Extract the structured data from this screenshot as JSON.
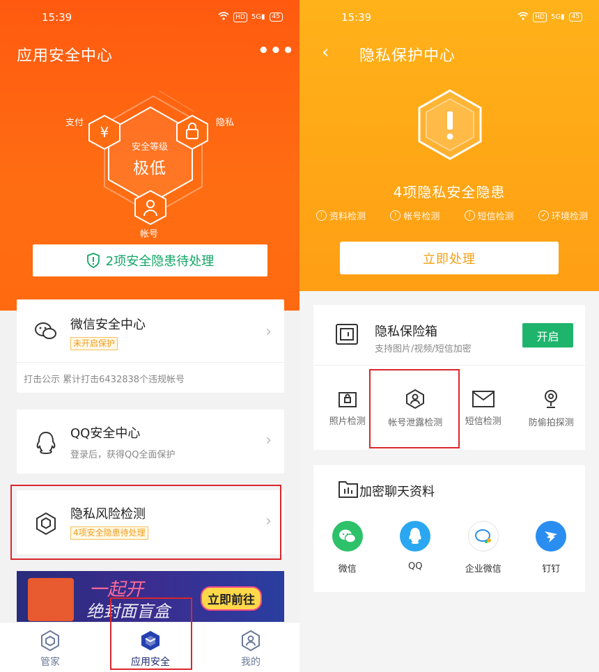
{
  "left": {
    "status_time": "15:39",
    "status_hd": "HD",
    "status_signal": "5G",
    "status_battery": "45",
    "title": "应用安全中心",
    "more_label": "•••",
    "hex_labels": {
      "pay": "支付",
      "privacy": "隐私",
      "account": "帐号"
    },
    "level_label": "安全等级",
    "level_value": "极低",
    "alert_text": "2项安全隐患待处理",
    "wechat": {
      "title": "微信安全中心",
      "badge": "未开启保护",
      "footnote": "打击公示   累计打击6432838个违规帐号"
    },
    "qq": {
      "title": "QQ安全中心",
      "sub": "登录后，获得QQ全面保护"
    },
    "privacy": {
      "title": "隐私风险检测",
      "badge": "4项安全隐患待处理"
    },
    "banner": {
      "text1": "一起开",
      "text2": "绝封面盲盒",
      "button": "立即前往"
    },
    "tabs": [
      {
        "label": "管家"
      },
      {
        "label": "应用安全"
      },
      {
        "label": "我的"
      }
    ]
  },
  "right": {
    "status_time": "15:39",
    "status_hd": "HD",
    "status_signal": "5G",
    "status_battery": "45",
    "back_label": "‹",
    "title": "隐私保护中心",
    "risk_title": "4项隐私安全隐患",
    "checks": [
      {
        "label": "资料检测",
        "icon": "!"
      },
      {
        "label": "帐号检测",
        "icon": "!"
      },
      {
        "label": "短信检测",
        "icon": "!"
      },
      {
        "label": "环境检测",
        "icon": "✓"
      }
    ],
    "handle_button": "立即处理",
    "vault": {
      "title": "隐私保险箱",
      "sub": "支持图片/视频/短信加密",
      "button": "开启"
    },
    "tools": [
      {
        "label": "照片检测"
      },
      {
        "label": "帐号泄露检测"
      },
      {
        "label": "短信检测"
      },
      {
        "label": "防偷拍探测"
      }
    ],
    "chat": {
      "title": "加密聊天资料"
    },
    "apps": [
      {
        "label": "微信"
      },
      {
        "label": "QQ"
      },
      {
        "label": "企业微信"
      },
      {
        "label": "钉钉"
      }
    ]
  },
  "colors": {
    "orange_header": "#ff5a10",
    "yellow_header": "#ffa716",
    "green_accent": "#12a567",
    "highlight_red": "#d9262c"
  }
}
